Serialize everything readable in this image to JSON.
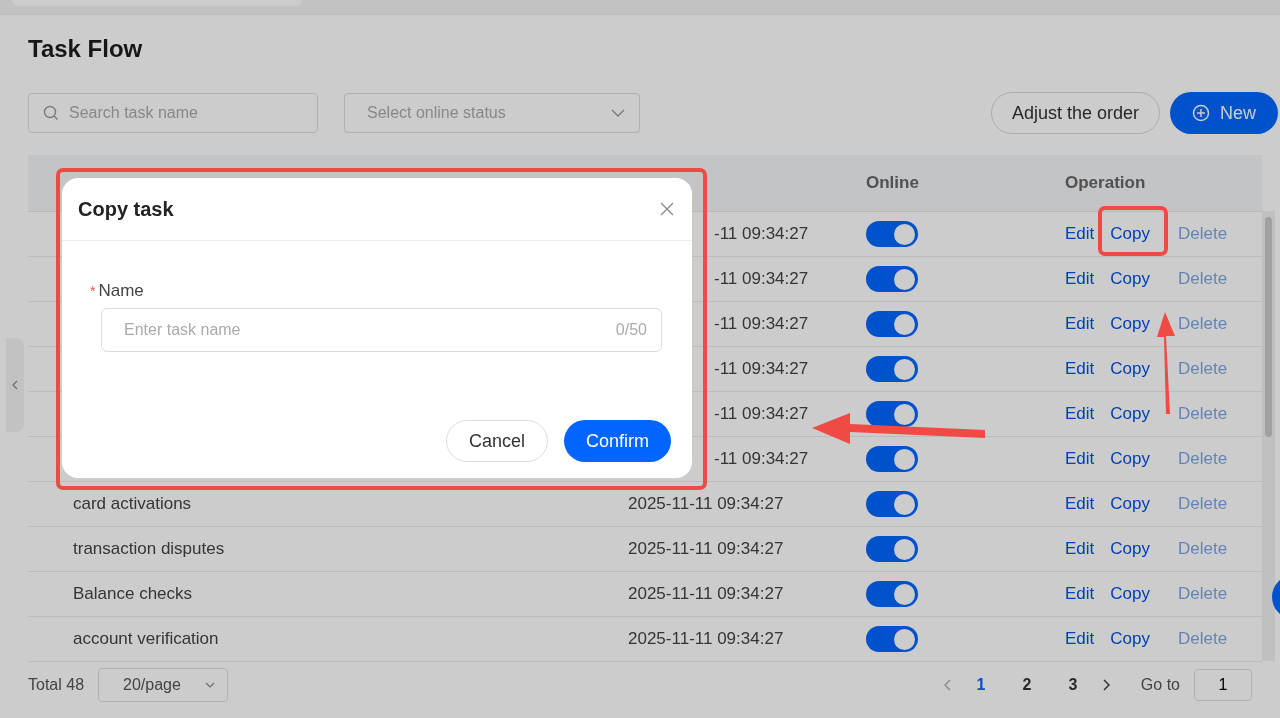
{
  "page": {
    "title": "Task Flow"
  },
  "filters": {
    "search": {
      "placeholder": "Search task name"
    },
    "status": {
      "placeholder": "Select online status"
    }
  },
  "actions": [
    {
      "label": "Adjust the order",
      "kind": "secondary"
    },
    {
      "label": "New",
      "kind": "primary"
    }
  ],
  "table": {
    "columns": [
      "Online",
      "Operation"
    ],
    "rows": [
      {
        "update": "-11 09:34:27",
        "online": true,
        "ops": [
          {
            "label": "Edit",
            "disabled": false
          },
          {
            "label": "Copy",
            "disabled": false
          },
          {
            "label": "Delete",
            "disabled": true
          }
        ]
      },
      {
        "update": "-11 09:34:27",
        "online": true,
        "ops": [
          {
            "label": "Edit",
            "disabled": false
          },
          {
            "label": "Copy",
            "disabled": false
          },
          {
            "label": "Delete",
            "disabled": true
          }
        ]
      },
      {
        "update": "-11 09:34:27",
        "online": true,
        "ops": [
          {
            "label": "Edit",
            "disabled": false
          },
          {
            "label": "Copy",
            "disabled": false
          },
          {
            "label": "Delete",
            "disabled": true
          }
        ]
      },
      {
        "update": "-11 09:34:27",
        "online": true,
        "ops": [
          {
            "label": "Edit",
            "disabled": false
          },
          {
            "label": "Copy",
            "disabled": false
          },
          {
            "label": "Delete",
            "disabled": true
          }
        ]
      },
      {
        "update": "-11 09:34:27",
        "online": true,
        "ops": [
          {
            "label": "Edit",
            "disabled": false
          },
          {
            "label": "Copy",
            "disabled": false
          },
          {
            "label": "Delete",
            "disabled": true
          }
        ]
      },
      {
        "update": "-11 09:34:27",
        "online": true,
        "ops": [
          {
            "label": "Edit",
            "disabled": false
          },
          {
            "label": "Copy",
            "disabled": false
          },
          {
            "label": "Delete",
            "disabled": true
          }
        ]
      },
      {
        "name": "card activations",
        "update": "2025-11-11 09:34:27",
        "online": true,
        "ops": [
          {
            "label": "Edit",
            "disabled": false
          },
          {
            "label": "Copy",
            "disabled": false
          },
          {
            "label": "Delete",
            "disabled": true
          }
        ]
      },
      {
        "name": "transaction disputes",
        "update": "2025-11-11 09:34:27",
        "online": true,
        "ops": [
          {
            "label": "Edit",
            "disabled": false
          },
          {
            "label": "Copy",
            "disabled": false
          },
          {
            "label": "Delete",
            "disabled": true
          }
        ]
      },
      {
        "name": "Balance checks",
        "update": "2025-11-11 09:34:27",
        "online": true,
        "ops": [
          {
            "label": "Edit",
            "disabled": false
          },
          {
            "label": "Copy",
            "disabled": false
          },
          {
            "label": "Delete",
            "disabled": true
          }
        ]
      },
      {
        "name": "account verification",
        "update": "2025-11-11 09:34:27",
        "online": true,
        "ops": [
          {
            "label": "Edit",
            "disabled": false
          },
          {
            "label": "Copy",
            "disabled": false
          },
          {
            "label": "Delete",
            "disabled": true
          }
        ]
      }
    ]
  },
  "pagination": {
    "total": "Total 48",
    "page_size": "20/page",
    "pages": [
      {
        "label": "1",
        "selected": true
      },
      {
        "label": "2",
        "selected": false
      },
      {
        "label": "3",
        "selected": false
      }
    ],
    "goto_label": "Go to",
    "goto_value": "1"
  },
  "modal": {
    "title": "Copy task",
    "field": {
      "label": "Name",
      "required": true,
      "required_mark": "*",
      "placeholder": "Enter task name",
      "counter": "0/50"
    },
    "buttons": [
      {
        "label": "Cancel",
        "kind": "secondary"
      },
      {
        "label": "Confirm",
        "kind": "primary"
      }
    ]
  }
}
